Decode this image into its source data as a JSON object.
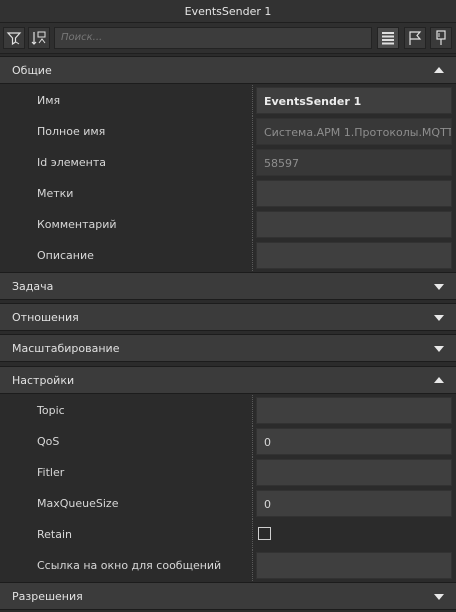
{
  "window": {
    "title": "EventsSender 1"
  },
  "toolbar": {
    "search_placeholder": "Поиск...",
    "icons": [
      "filter-icon",
      "sort-icon",
      "list-view-icon",
      "flag-icon",
      "pin-icon"
    ]
  },
  "sections": {
    "general": {
      "label": "Общие",
      "expanded": true
    },
    "task": {
      "label": "Задача",
      "expanded": false
    },
    "relations": {
      "label": "Отношения",
      "expanded": false
    },
    "scaling": {
      "label": "Масштабирование",
      "expanded": false
    },
    "settings": {
      "label": "Настройки",
      "expanded": true
    },
    "permissions": {
      "label": "Разрешения",
      "expanded": false
    }
  },
  "general": {
    "name": {
      "label": "Имя",
      "value": "EventsSender 1"
    },
    "full_name": {
      "label": "Полное имя",
      "value": "Система.АРМ 1.Протоколы.MQTT"
    },
    "element_id": {
      "label": "Id элемента",
      "value": "58597"
    },
    "tags": {
      "label": "Метки",
      "value": ""
    },
    "comment": {
      "label": "Комментарий",
      "value": ""
    },
    "description": {
      "label": "Описание",
      "value": ""
    }
  },
  "settings": {
    "topic": {
      "label": "Topic",
      "value": ""
    },
    "qos": {
      "label": "QoS",
      "value": "0"
    },
    "filter": {
      "label": "Fitler",
      "value": ""
    },
    "max_queue": {
      "label": "MaxQueueSize",
      "value": "0"
    },
    "retain": {
      "label": "Retain",
      "checked": false
    },
    "window_link": {
      "label": "Ссылка на окно для сообщений",
      "value": ""
    }
  }
}
